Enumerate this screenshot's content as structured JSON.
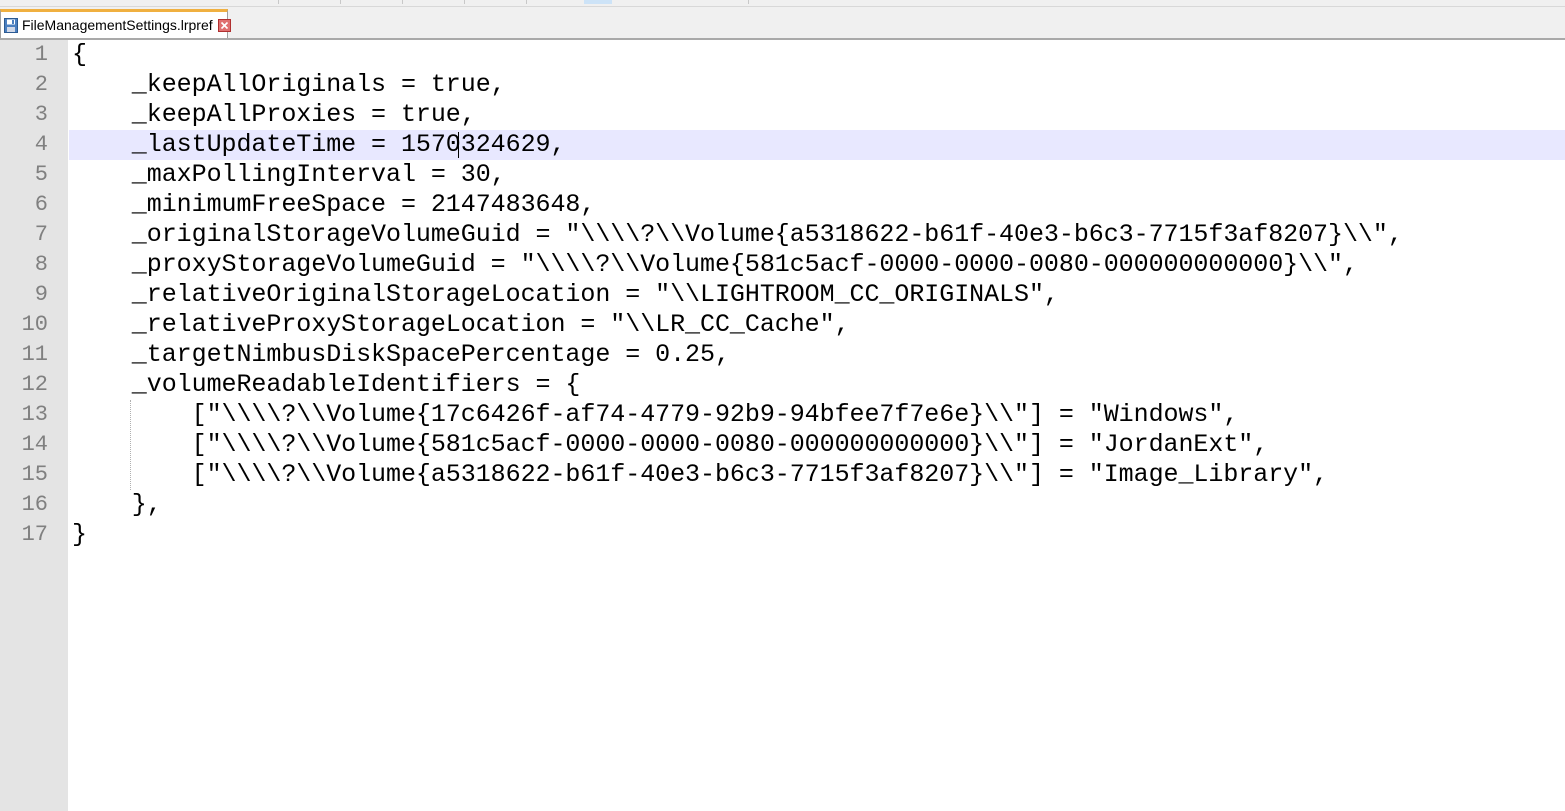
{
  "tab": {
    "title": "FileManagementSettings.lrpref",
    "icon": "saved-file-icon",
    "close_icon": "close-icon"
  },
  "editor": {
    "current_line": 4,
    "lines": [
      {
        "num": "1",
        "text": "{"
      },
      {
        "num": "2",
        "text": "    _keepAllOriginals = true,"
      },
      {
        "num": "3",
        "text": "    _keepAllProxies = true,"
      },
      {
        "num": "4",
        "text": "    _lastUpdateTime = 1570324629,"
      },
      {
        "num": "5",
        "text": "    _maxPollingInterval = 30,"
      },
      {
        "num": "6",
        "text": "    _minimumFreeSpace = 2147483648,"
      },
      {
        "num": "7",
        "text": "    _originalStorageVolumeGuid = \"\\\\\\\\?\\\\Volume{a5318622-b61f-40e3-b6c3-7715f3af8207}\\\\\","
      },
      {
        "num": "8",
        "text": "    _proxyStorageVolumeGuid = \"\\\\\\\\?\\\\Volume{581c5acf-0000-0000-0080-000000000000}\\\\\","
      },
      {
        "num": "9",
        "text": "    _relativeOriginalStorageLocation = \"\\\\LIGHTROOM_CC_ORIGINALS\","
      },
      {
        "num": "10",
        "text": "    _relativeProxyStorageLocation = \"\\\\LR_CC_Cache\","
      },
      {
        "num": "11",
        "text": "    _targetNimbusDiskSpacePercentage = 0.25,"
      },
      {
        "num": "12",
        "text": "    _volumeReadableIdentifiers = {"
      },
      {
        "num": "13",
        "text": "        [\"\\\\\\\\?\\\\Volume{17c6426f-af74-4779-92b9-94bfee7f7e6e}\\\\\"] = \"Windows\","
      },
      {
        "num": "14",
        "text": "        [\"\\\\\\\\?\\\\Volume{581c5acf-0000-0000-0080-000000000000}\\\\\"] = \"JordanExt\","
      },
      {
        "num": "15",
        "text": "        [\"\\\\\\\\?\\\\Volume{a5318622-b61f-40e3-b6c3-7715f3af8207}\\\\\"] = \"Image_Library\","
      },
      {
        "num": "16",
        "text": "    },"
      },
      {
        "num": "17",
        "text": "}"
      }
    ]
  },
  "colors": {
    "gutter_bg": "#e4e4e4",
    "current_line_bg": "#e8e8ff",
    "line_number": "#808080",
    "tab_accent": "#f0b040"
  }
}
